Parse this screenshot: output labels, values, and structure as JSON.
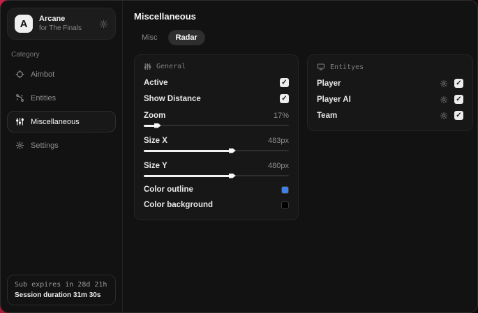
{
  "app": {
    "name": "Arcane",
    "subtitle": "for The Finals",
    "logo_letter": "A"
  },
  "sidebar": {
    "category_label": "Category",
    "items": [
      {
        "label": "Aimbot",
        "icon": "crosshair-icon"
      },
      {
        "label": "Entities",
        "icon": "nodes-icon"
      },
      {
        "label": "Miscellaneous",
        "icon": "sliders-icon",
        "selected": true
      },
      {
        "label": "Settings",
        "icon": "gear-icon"
      }
    ],
    "selected_dots": "......",
    "sub_expires": "Sub expires in 28d 21h",
    "session_duration": "Session duration 31m 30s"
  },
  "main": {
    "title": "Miscellaneous",
    "tabs": [
      {
        "label": "Misc",
        "active": false
      },
      {
        "label": "Radar",
        "active": true
      }
    ]
  },
  "general_panel": {
    "title": "General",
    "active": {
      "label": "Active",
      "checked": true
    },
    "show_distance": {
      "label": "Show Distance",
      "checked": true
    },
    "zoom": {
      "label": "Zoom",
      "value": "17%",
      "percent": 8.5
    },
    "size_x": {
      "label": "Size X",
      "value": "483px",
      "percent": 60
    },
    "size_y": {
      "label": "Size Y",
      "value": "480px",
      "percent": 60
    },
    "color_outline": {
      "label": "Color outline",
      "color": "#3f80ea"
    },
    "color_background": {
      "label": "Color background",
      "color": "#000000"
    }
  },
  "entities_panel": {
    "title": "Entityes",
    "rows": [
      {
        "label": "Player",
        "checked": true
      },
      {
        "label": "Player AI",
        "checked": true
      },
      {
        "label": "Team",
        "checked": true
      }
    ]
  },
  "icons": {
    "check": "✓"
  },
  "colors": {
    "accent_blue": "#3f80ea",
    "backdrop_red": "#c22448"
  }
}
